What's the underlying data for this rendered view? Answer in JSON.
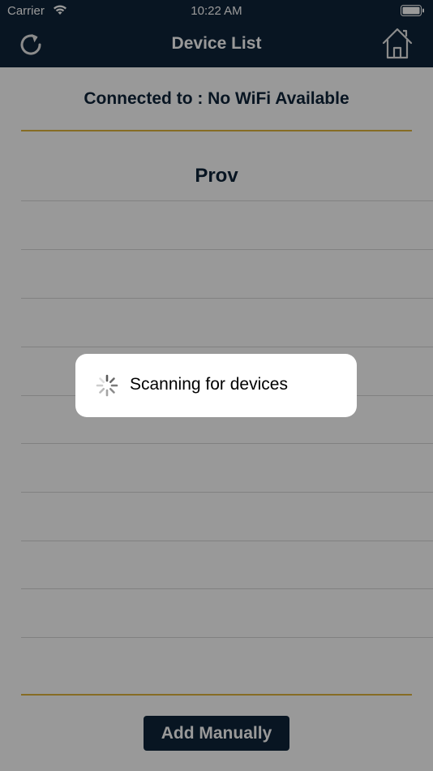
{
  "status_bar": {
    "carrier": "Carrier",
    "time": "10:22 AM",
    "icons": [
      "wifi-icon",
      "battery-icon"
    ]
  },
  "nav": {
    "title": "Device List",
    "left_icon": "refresh-icon",
    "right_icon": "home-icon"
  },
  "connection": {
    "label": "Connected to : No WiFi Available"
  },
  "device_section": {
    "title": "Prov",
    "rows": []
  },
  "footer": {
    "add_manually_label": "Add Manually"
  },
  "loading_hud": {
    "message": "Scanning for devices",
    "icon": "spinner-icon"
  },
  "colors": {
    "navbar": "#0e2339",
    "accent_line": "#e0b43c",
    "text_primary": "#0e2339",
    "overlay": "rgba(0,0,0,0.4)"
  }
}
